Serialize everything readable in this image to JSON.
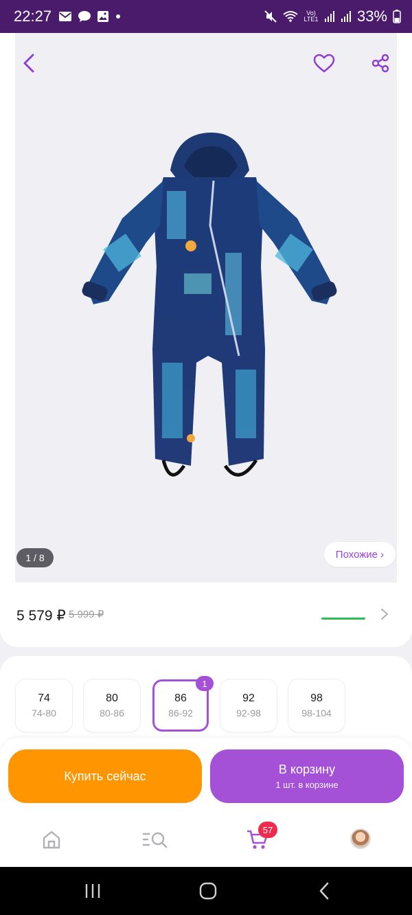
{
  "status_bar": {
    "time": "22:27",
    "battery": "33%",
    "network_label": "Vo) LTE1",
    "icons": [
      "mail-icon",
      "chat-icon",
      "image-icon",
      "dot-icon",
      "mute-icon",
      "wifi-icon",
      "signal-icon",
      "signal-icon",
      "battery-icon"
    ]
  },
  "photo": {
    "counter": "1 / 8",
    "similar_label": "Похожие ›",
    "icons": {
      "back": "back-icon",
      "favorite": "heart-icon",
      "share": "share-icon"
    }
  },
  "price": {
    "current": "5 579 ₽",
    "old": "5 999 ₽",
    "accent_color": "#2ebc55"
  },
  "sizes": {
    "items": [
      {
        "size": "74",
        "range": "74-80"
      },
      {
        "size": "80",
        "range": "80-86"
      },
      {
        "size": "86",
        "range": "86-92"
      },
      {
        "size": "92",
        "range": "92-98"
      },
      {
        "size": "98",
        "range": "98-104"
      }
    ],
    "selected_index": 2,
    "selected_badge": "1"
  },
  "actions": {
    "buy_now": "Купить сейчас",
    "add_to_cart": "В корзину",
    "in_cart": "1 шт. в корзине",
    "buy_color": "#ff9500",
    "cart_color": "#a451d7"
  },
  "bottom_nav": {
    "items": [
      "home-icon",
      "catalog-search-icon",
      "cart-icon",
      "profile-avatar"
    ],
    "cart_badge": "57"
  }
}
